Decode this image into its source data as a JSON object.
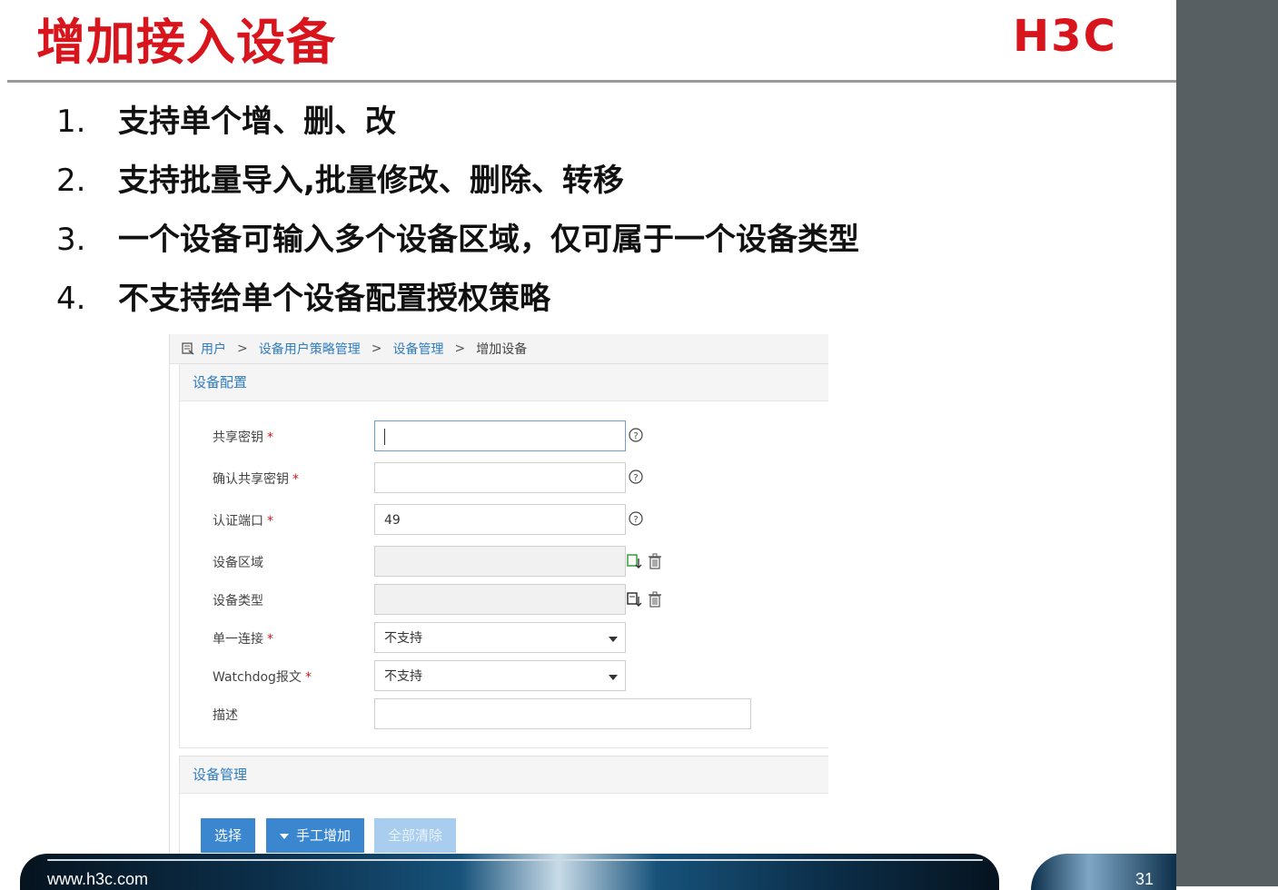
{
  "slide": {
    "title": "增加接入设备",
    "logo_text": "H3C",
    "bullets": [
      {
        "num": "1.",
        "text": "支持单个增、删、改"
      },
      {
        "num": "2.",
        "text": "支持批量导入,批量修改、删除、转移"
      },
      {
        "num": "3.",
        "text": "一个设备可输入多个设备区域，仅可属于一个设备类型"
      },
      {
        "num": "4.",
        "text": "不支持给单个设备配置授权策略"
      }
    ],
    "footer_url": "www.h3c.com",
    "page_number": "31",
    "colors": {
      "title": "#d8151d",
      "accent": "#3a86cf",
      "side_band": "#575f63"
    }
  },
  "breadcrumb": {
    "items": [
      "用户",
      "设备用户策略管理",
      "设备管理"
    ],
    "separator": ">",
    "current": "增加设备"
  },
  "device_config": {
    "header": "设备配置",
    "required_mark": "*",
    "fields": {
      "shared_key": {
        "label": "共享密钥",
        "value": ""
      },
      "confirm_key": {
        "label": "确认共享密钥",
        "value": ""
      },
      "auth_port": {
        "label": "认证端口",
        "value": "49"
      },
      "device_area": {
        "label": "设备区域",
        "value": ""
      },
      "device_type": {
        "label": "设备类型",
        "value": ""
      },
      "single_connect": {
        "label": "单一连接",
        "value": "不支持"
      },
      "watchdog": {
        "label": "Watchdog报文",
        "value": "不支持"
      },
      "description": {
        "label": "描述",
        "value": ""
      }
    }
  },
  "device_mgmt": {
    "header": "设备管理",
    "buttons": {
      "select": "选择",
      "manual_add": "手工增加",
      "clear_all": "全部清除"
    }
  }
}
